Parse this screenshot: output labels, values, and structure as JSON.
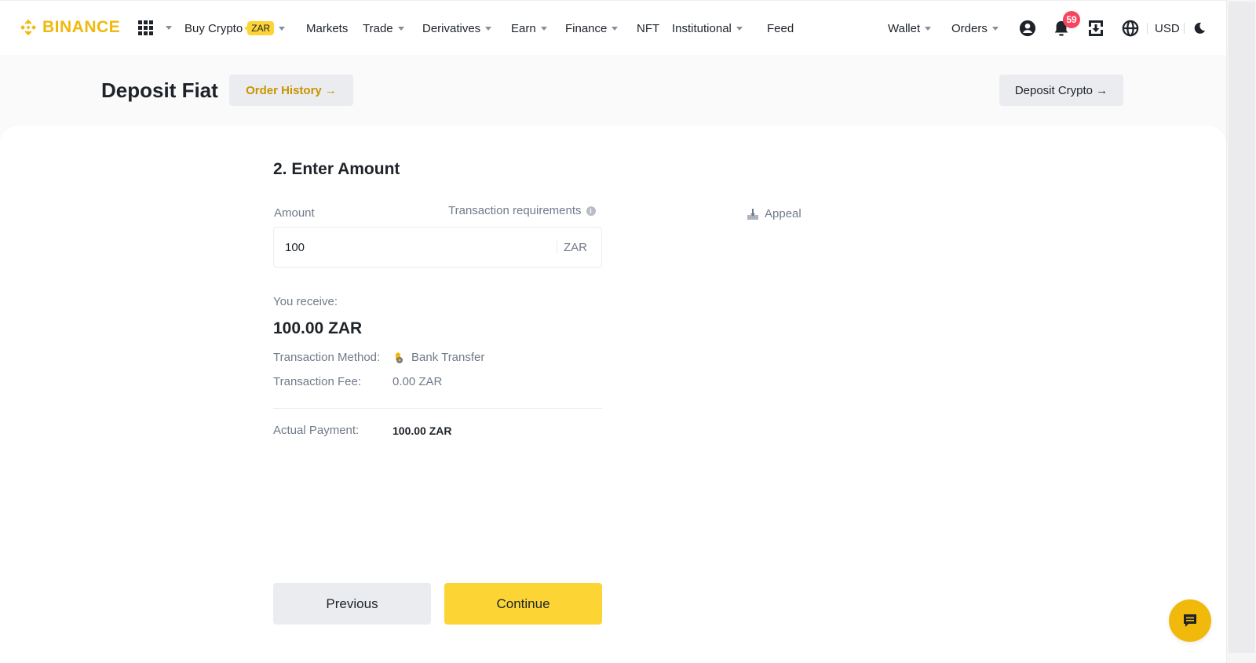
{
  "header": {
    "brand": "BINANCE",
    "nav": [
      {
        "label": "Buy Crypto",
        "badge": "ZAR",
        "has_dropdown": true
      },
      {
        "label": "Markets",
        "has_dropdown": false
      },
      {
        "label": "Trade",
        "has_dropdown": true
      },
      {
        "label": "Derivatives",
        "has_dropdown": true
      },
      {
        "label": "Earn",
        "has_dropdown": true
      },
      {
        "label": "Finance",
        "has_dropdown": true
      },
      {
        "label": "NFT",
        "has_dropdown": false
      },
      {
        "label": "Institutional",
        "has_dropdown": true
      },
      {
        "label": "Feed",
        "has_dropdown": false
      }
    ],
    "right": {
      "wallet": "Wallet",
      "orders": "Orders",
      "notification_count": "59",
      "currency": "USD"
    },
    "icons": [
      "apps-grid-icon",
      "user-icon",
      "bell-icon",
      "download-icon",
      "globe-icon",
      "moon-icon"
    ]
  },
  "page": {
    "title": "Deposit Fiat",
    "order_history": "Order History →",
    "deposit_crypto": "Deposit Crypto →"
  },
  "form": {
    "step_title": "2. Enter Amount",
    "amount_label": "Amount",
    "requirements_label": "Transaction requirements",
    "amount_value": "100",
    "currency": "ZAR",
    "appeal": "Appeal"
  },
  "summary": {
    "you_receive_label": "You receive:",
    "you_receive_value": "100.00 ZAR",
    "method_label": "Transaction Method:",
    "method_value": "Bank Transfer",
    "fee_label": "Transaction Fee:",
    "fee_value": "0.00 ZAR",
    "actual_label": "Actual Payment:",
    "actual_value": "100.00 ZAR"
  },
  "actions": {
    "previous": "Previous",
    "continue": "Continue"
  },
  "colors": {
    "brand": "#F0B90B",
    "primary_button": "#FCD535",
    "badge_red": "#F6465D",
    "link_gold": "#C99400"
  }
}
